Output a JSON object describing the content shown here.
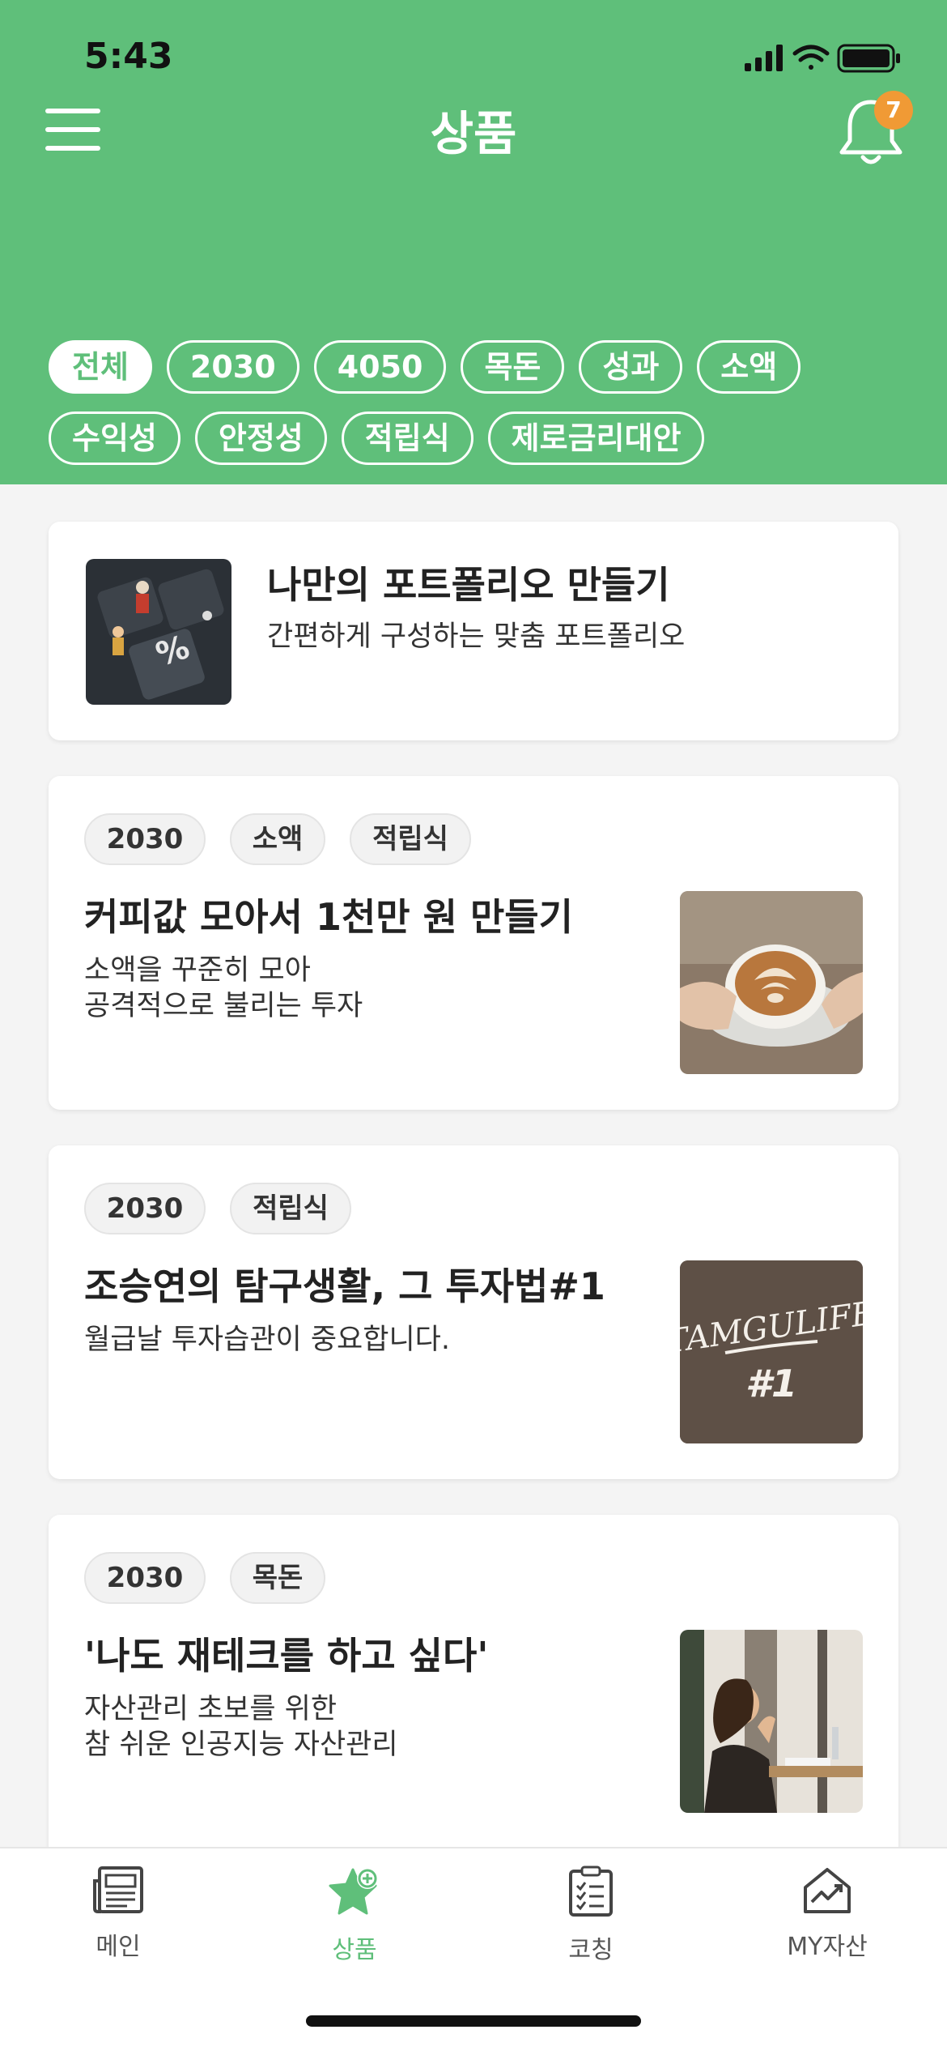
{
  "status": {
    "time": "5:43"
  },
  "header": {
    "title": "상품",
    "notification_count": "7",
    "background_color": "#5fbf7a",
    "badge_color": "#f09a35"
  },
  "filters": {
    "row1": [
      "전체",
      "2030",
      "4050",
      "목돈",
      "성과",
      "소액"
    ],
    "row2": [
      "수익성",
      "안정성",
      "적립식",
      "제로금리대안"
    ],
    "selected": "전체"
  },
  "portfolio_card": {
    "title": "나만의 포트폴리오 만들기",
    "description": "간편하게 구성하는 맞춤 포트폴리오"
  },
  "products": [
    {
      "tags": [
        "2030",
        "소액",
        "적립식"
      ],
      "title": "커피값 모아서 1천만 원 만들기",
      "description": [
        "소액을 꾸준히 모아",
        "공격적으로 불리는 투자"
      ]
    },
    {
      "tags": [
        "2030",
        "적립식"
      ],
      "title": "조승연의 탐구생활, 그 투자법#1",
      "description": [
        "월급날 투자습관이 중요합니다."
      ],
      "thumb_text": [
        "TAMGULIFE",
        "#1"
      ]
    },
    {
      "tags": [
        "2030",
        "목돈"
      ],
      "title": "'나도 재테크를 하고 싶다'",
      "description": [
        "자산관리 초보를 위한",
        "참 쉬운 인공지능 자산관리"
      ]
    }
  ],
  "tabbar": {
    "items": [
      {
        "label": "메인",
        "icon": "newspaper-icon"
      },
      {
        "label": "상품",
        "icon": "star-plus-icon"
      },
      {
        "label": "코칭",
        "icon": "clipboard-icon"
      },
      {
        "label": "MY자산",
        "icon": "house-chart-icon"
      }
    ],
    "active": "상품"
  }
}
